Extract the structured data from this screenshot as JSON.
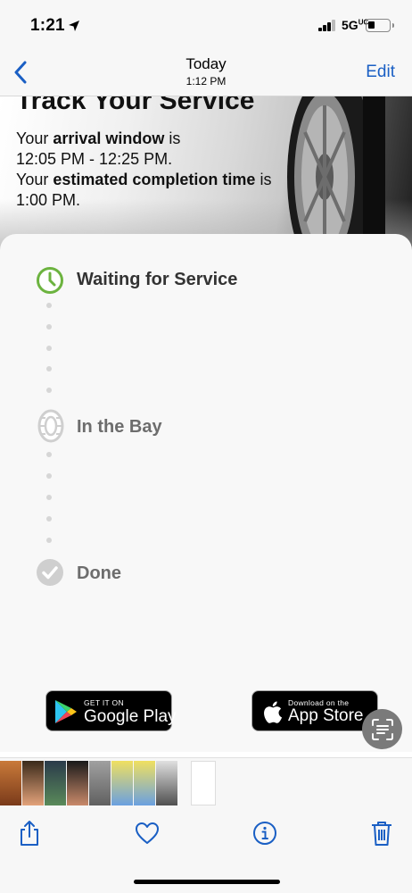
{
  "status_bar": {
    "time": "1:21",
    "network": "5G",
    "network_sup": "UC",
    "battery_level": 0.2
  },
  "nav": {
    "back_label": "Back",
    "title": "Today",
    "subtitle": "1:12 PM",
    "edit_label": "Edit"
  },
  "hero": {
    "title": "Track Your Service",
    "line1_prefix": "Your ",
    "line1_bold": "arrival window",
    "line1_suffix": " is",
    "line2": "12:05 PM - 12:25 PM.",
    "line3_prefix": "Your ",
    "line3_bold": "estimated completion time",
    "line3_suffix": " is",
    "line4": "1:00 PM."
  },
  "steps": [
    {
      "label": "Waiting for Service",
      "icon": "clock-icon",
      "active": true
    },
    {
      "label": "In the Bay",
      "icon": "tire-icon",
      "active": false
    },
    {
      "label": "Done",
      "icon": "check-circle-icon",
      "active": false
    }
  ],
  "badges": {
    "google_small": "GET IT ON",
    "google_big": "Google Play",
    "apple_small": "Download on the",
    "apple_big": "App Store"
  },
  "colors": {
    "accent": "#1a5fc4",
    "active_step": "#6cb33f",
    "inactive_step": "#cfcfcf",
    "active_text": "#333333",
    "inactive_text": "#6d6d6d"
  }
}
